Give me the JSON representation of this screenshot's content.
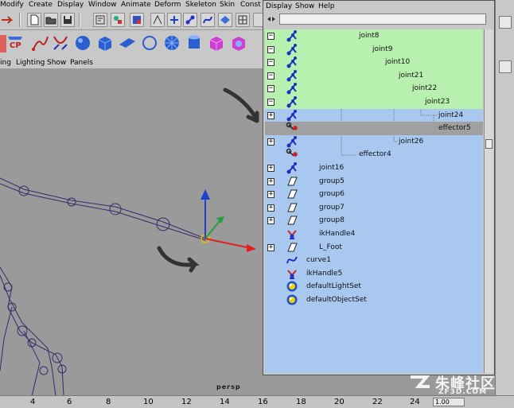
{
  "main_menu": [
    "Modify",
    "Create",
    "Display",
    "Window",
    "Animate",
    "Deform",
    "Skeleton",
    "Skin",
    "Const"
  ],
  "shelf_badge": "CP",
  "viewport": {
    "menu": [
      "ing",
      "Lighting",
      "Show",
      "Panels"
    ],
    "camera_label": "persp"
  },
  "outliner": {
    "menu": [
      "Display",
      "Show",
      "Help"
    ],
    "filter_value": "",
    "items": [
      {
        "label": "joint8",
        "expander": "−",
        "icon": "joint-icon",
        "state": "selected"
      },
      {
        "label": "joint9",
        "expander": "−",
        "icon": "joint-icon",
        "state": "selected"
      },
      {
        "label": "joint10",
        "expander": "−",
        "icon": "joint-icon",
        "state": "selected"
      },
      {
        "label": "joint21",
        "expander": "−",
        "icon": "joint-icon",
        "state": "selected"
      },
      {
        "label": "joint22",
        "expander": "−",
        "icon": "joint-icon",
        "state": "selected"
      },
      {
        "label": "joint23",
        "expander": "−",
        "icon": "joint-icon",
        "state": "selected"
      },
      {
        "label": "joint24",
        "expander": "+",
        "icon": "joint-icon",
        "state": "normal"
      },
      {
        "label": "effector5",
        "expander": "",
        "icon": "effector-icon",
        "state": "highlight"
      },
      {
        "label": "joint26",
        "expander": "+",
        "icon": "joint-icon",
        "state": "normal"
      },
      {
        "label": "effector4",
        "expander": "",
        "icon": "effector-icon",
        "state": "normal"
      },
      {
        "label": "joint16",
        "expander": "+",
        "icon": "joint-icon",
        "state": "normal"
      },
      {
        "label": "group5",
        "expander": "+",
        "icon": "group-icon",
        "state": "normal"
      },
      {
        "label": "group6",
        "expander": "+",
        "icon": "group-icon",
        "state": "normal"
      },
      {
        "label": "group7",
        "expander": "+",
        "icon": "group-icon",
        "state": "normal"
      },
      {
        "label": "group8",
        "expander": "+",
        "icon": "group-icon",
        "state": "normal"
      },
      {
        "label": "ikHandle4",
        "expander": "",
        "icon": "ik-handle-icon",
        "state": "normal"
      },
      {
        "label": "L_Foot",
        "expander": "+",
        "icon": "group-icon",
        "state": "normal"
      },
      {
        "label": "curve1",
        "expander": "",
        "icon": "curve-icon",
        "state": "normal"
      },
      {
        "label": "ikHandle5",
        "expander": "",
        "icon": "ik-handle-icon",
        "state": "normal"
      },
      {
        "label": "defaultLightSet",
        "expander": "",
        "icon": "set-icon",
        "state": "normal"
      },
      {
        "label": "defaultObjectSet",
        "expander": "",
        "icon": "set-icon",
        "state": "normal"
      }
    ]
  },
  "timeline_ticks": [
    "4",
    "6",
    "8",
    "10",
    "12",
    "14",
    "16",
    "18",
    "20",
    "22",
    "24"
  ],
  "timeline_field": "1.00",
  "watermark": {
    "text": "朱峰社区",
    "url": "ZF3D.COM"
  },
  "colors": {
    "outliner_bg": "#a8c8f0",
    "selected": "#b8f0b0",
    "highlight": "#a0a0a0",
    "joint": "#2030c0"
  }
}
